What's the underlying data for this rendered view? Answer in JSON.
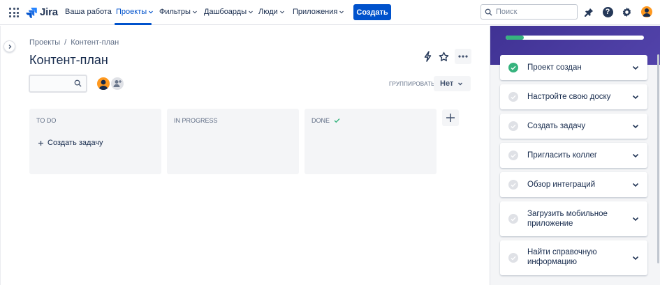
{
  "nav": {
    "logo": "Jira",
    "items": [
      {
        "label": "Ваша работа",
        "has_dropdown": false
      },
      {
        "label": "Проекты",
        "has_dropdown": true,
        "active": true
      },
      {
        "label": "Фильтры",
        "has_dropdown": true
      },
      {
        "label": "Дашбоарды",
        "has_dropdown": true
      },
      {
        "label": "Люди",
        "has_dropdown": true
      },
      {
        "label": "Приложения",
        "has_dropdown": true
      }
    ],
    "create_label": "Создать",
    "search_placeholder": "Поиск",
    "accent": "#0052CC"
  },
  "breadcrumb": [
    "Проекты",
    "/",
    "Контент-план"
  ],
  "page": {
    "title": "Контент-план",
    "group_label": "ГРУППИРОВАТЬ:",
    "group_value": "Нет"
  },
  "board": {
    "columns": [
      {
        "title": "TO DO",
        "create_label": "Создать задачу"
      },
      {
        "title": "IN PROGRESS"
      },
      {
        "title": "DONE",
        "done_check": true
      }
    ]
  },
  "checklist": {
    "progress_fraction": 0.13,
    "items": [
      {
        "label": "Проект создан",
        "done": true
      },
      {
        "label": "Настройте свою доску",
        "done": false
      },
      {
        "label": "Создать задачу",
        "done": false
      },
      {
        "label": "Пригласить коллег",
        "done": false
      },
      {
        "label": "Обзор интеграций",
        "done": false
      },
      {
        "label": "Загрузить мобильное приложение",
        "done": false
      },
      {
        "label": "Найти справочную информацию",
        "done": false
      }
    ],
    "header_color": "#403294",
    "done_color": "#36B37E"
  }
}
